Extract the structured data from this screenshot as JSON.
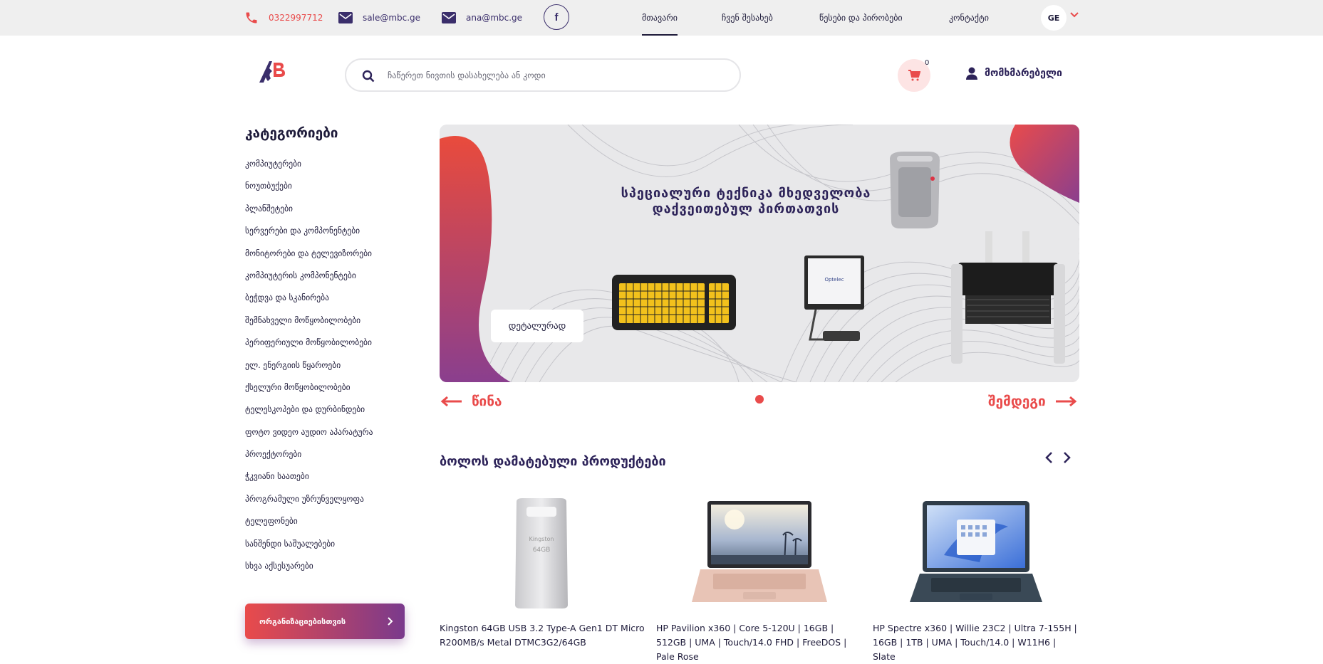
{
  "topbar": {
    "phone": "0322997712",
    "email1": "sale@mbc.ge",
    "email2": "ana@mbc.ge",
    "facebook": "f",
    "nav": [
      "მთავარი",
      "ჩვენ შესახებ",
      "წესები და პირობები",
      "კონტაქტი"
    ],
    "active_nav": "მთავარი",
    "language": "GE"
  },
  "header": {
    "search_placeholder": "ჩაწერეთ ნივთის დასახელება ან კოდი",
    "cart_count": "0",
    "user_label": "მომხმარებელი"
  },
  "sidebar": {
    "title": "კატეგორიები",
    "categories": [
      "კომპიუტერები",
      "ნოუთბუქები",
      "პლანშეტები",
      "სერვერები და კომპონენტები",
      "მონიტორები და ტელევიზორები",
      "კომპიუტერის კომპონენტები",
      "ბეჭდვა და სკანირება",
      "შემნახველი მოწყობილობები",
      "პერიფერიული მოწყობილობები",
      "ელ. ენერგიის წყაროები",
      "ქსელური მოწყობილობები",
      "ტელესკოპები და დურბინდები",
      "ფოტო ვიდეო აუდიო აპარატურა",
      "პროექტორები",
      "ჭკვიანი საათები",
      "პროგრამული უზრუნველყოფა",
      "ტელეფონები",
      "სანშენდი საშუალებები",
      "სხვა აქსესუარები"
    ],
    "org_button": "ორგანიზაციებისთვის"
  },
  "banner": {
    "title_line1": "სპეციალური ტექნიკა მხედველობა",
    "title_line2": "დაქვეითებულ პირთათვის",
    "detail_button": "დეტალურად",
    "prev_label": "წინა",
    "next_label": "შემდეგი"
  },
  "products": {
    "section_title": "ბოლოს დამატებული პროდუქტები",
    "items": [
      {
        "name": "Kingston 64GB USB 3.2 Type-A Gen1 DT Micro R200MB/s Metal DTMC3G2/64GB",
        "image": "usb-flash-drive"
      },
      {
        "name": "HP Pavilion x360 | Core 5-120U | 16GB | 512GB | UMA | Touch/14.0 FHD | FreeDOS | Pale Rose",
        "image": "laptop-pink"
      },
      {
        "name": "HP Spectre x360 | Willie 23C2 | Ultra 7-155H | 16GB | 1TB | UMA | Touch/14.0 | W11H6 | Slate",
        "image": "laptop-slate"
      }
    ]
  },
  "colors": {
    "accent": "#e94b4b",
    "primary": "#2d2359",
    "topbar": "#efefef"
  }
}
